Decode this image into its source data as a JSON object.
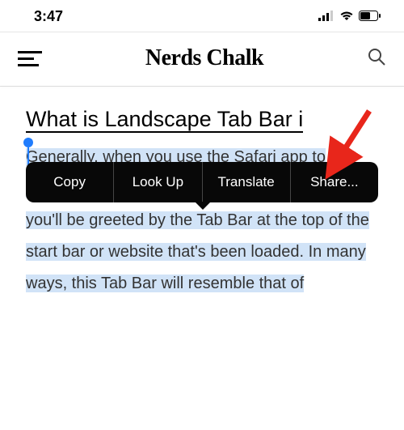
{
  "status": {
    "time": "3:47"
  },
  "header": {
    "site_title": "Nerds Chalk"
  },
  "article": {
    "title": "What is Landscape Tab Bar i",
    "body": "Generally, when you use the Safari app to browse websites on iOS 15 in landscape mode, you'll be greeted by the Tab Bar at the top of the start bar or website that's been loaded. In many ways, this Tab Bar will resemble that of"
  },
  "context_menu": {
    "items": [
      "Copy",
      "Look Up",
      "Translate",
      "Share..."
    ]
  }
}
